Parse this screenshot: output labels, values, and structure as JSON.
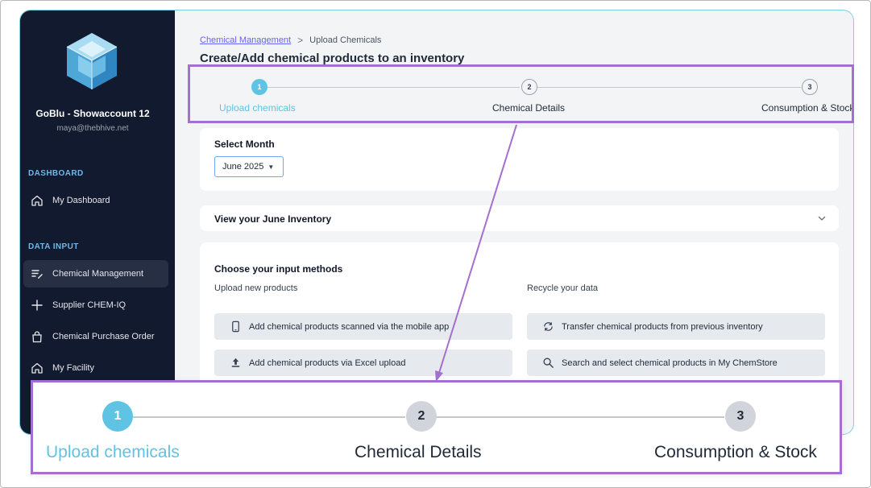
{
  "sidebar": {
    "account_name": "GoBlu - Showaccount 12",
    "account_email": "maya@thebhive.net",
    "section_dashboard": "DASHBOARD",
    "dashboard_item": "My Dashboard",
    "section_data_input": "DATA INPUT",
    "items": [
      {
        "label": "Chemical Management",
        "icon": "edit-list-icon",
        "active": true
      },
      {
        "label": "Supplier CHEM-IQ",
        "icon": "plus-icon"
      },
      {
        "label": "Chemical Purchase Order",
        "icon": "bag-icon"
      },
      {
        "label": "My Facility",
        "icon": "home-icon"
      }
    ]
  },
  "breadcrumb": {
    "link": "Chemical Management",
    "separator": ">",
    "current": "Upload Chemicals"
  },
  "page_title": "Create/Add chemical products to an inventory",
  "stepper": {
    "steps": [
      {
        "number": "1",
        "label": "Upload chemicals",
        "active": true
      },
      {
        "number": "2",
        "label": "Chemical Details"
      },
      {
        "number": "3",
        "label": "Consumption & Stock"
      }
    ]
  },
  "select_month": {
    "label": "Select Month",
    "value": "June 2025"
  },
  "view_inventory": {
    "label": "View your June Inventory"
  },
  "input_methods": {
    "title": "Choose your input methods",
    "upload_label": "Upload new products",
    "recycle_label": "Recycle your data",
    "upload_buttons": [
      {
        "label": "Add chemical products scanned via the mobile app",
        "icon": "mobile-phone-icon"
      },
      {
        "label": "Add chemical products via Excel upload",
        "icon": "upload-icon"
      }
    ],
    "recycle_buttons": [
      {
        "label": "Transfer chemical products from previous inventory",
        "icon": "transfer-cycle-icon"
      },
      {
        "label": "Search and select chemical products in My ChemStore",
        "icon": "search-icon"
      }
    ]
  },
  "colors": {
    "sidebar_bg": "#111a2e",
    "accent": "#5fc3e4",
    "highlight": "#a56fd1",
    "link": "#6366f1"
  }
}
